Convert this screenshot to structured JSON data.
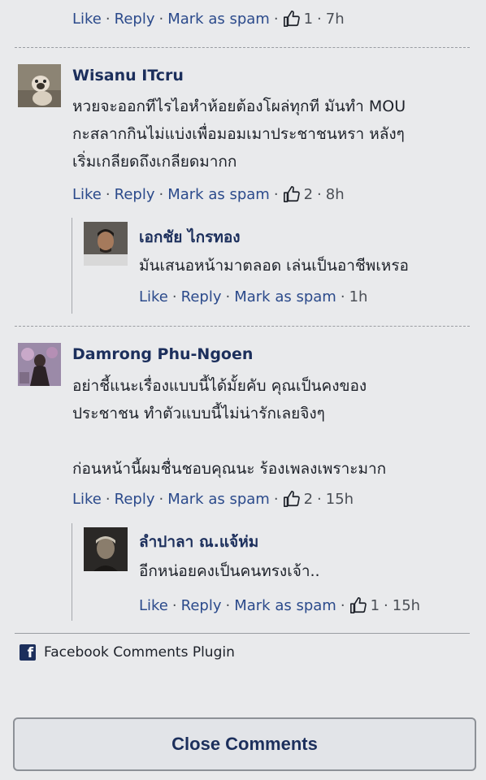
{
  "labels": {
    "like": "Like",
    "reply": "Reply",
    "mark_as_spam": "Mark as spam",
    "dot": "·"
  },
  "top_comment": {
    "likes": "1",
    "time": "7h"
  },
  "comments": [
    {
      "author": "Wisanu ITcru",
      "text_lines": [
        "หวยจะออกทีไรไอหำห้อยต้องโผล่ทุกที มันทำ MOU",
        "กะสลากกินไม่แบ่งเพื่อมอมเมาประชาชนหรา หลังๆ",
        "เริ่มเกลียดถึงเกลียดมากก"
      ],
      "likes": "2",
      "time": "8h",
      "reply": {
        "author": "เอกชัย ไกรทอง",
        "text": "มันเสนอหน้ามาตลอด เล่นเป็นอาชีพเหรอ",
        "time": "1h"
      }
    },
    {
      "author": "Damrong Phu-Ngoen",
      "text_lines": [
        "อย่าชี้แนะเรื่องแบบนี้ได้มั้ยคับ คุณเป็นคงของ",
        "ประชาชน ทำตัวแบบนี้ไม่น่ารักเลยจิงๆ",
        "",
        "ก่อนหน้านี้ผมชื่นชอบคุณนะ ร้องเพลงเพราะมาก"
      ],
      "likes": "2",
      "time": "15h",
      "reply": {
        "author": "ลำปาลา ณ.แจ้ห่ม",
        "text": "อีกหน่อยคงเป็นคนทรงเจ้า..",
        "likes": "1",
        "time": "15h"
      }
    }
  ],
  "footer": {
    "plugin_label": "Facebook Comments Plugin",
    "fb_icon": "facebook-f-icon",
    "close_label": "Close Comments"
  },
  "colors": {
    "background": "#e9eaec",
    "link": "#2b4a8b",
    "author": "#1c2f5c"
  }
}
